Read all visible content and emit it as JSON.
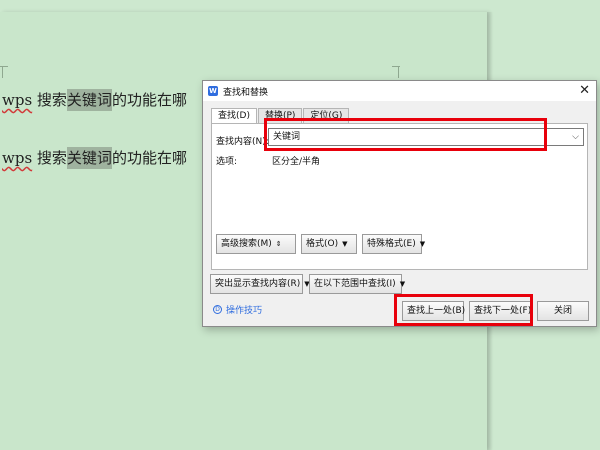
{
  "document": {
    "lines": [
      {
        "latin": "wps",
        "before": " 搜索",
        "highlight": "关键词",
        "after": "的功能在哪"
      },
      {
        "latin": "wps",
        "before": " 搜索",
        "highlight": "关键词",
        "after": "的功能在哪"
      }
    ]
  },
  "dialog": {
    "app_icon": "W",
    "title": "查找和替换",
    "tabs": [
      {
        "label": "查找(D)",
        "active": true
      },
      {
        "label": "替换(P)",
        "active": false
      },
      {
        "label": "定位(G)",
        "active": false
      }
    ],
    "find_label": "查找内容(N):",
    "find_value": "关键词",
    "options_label": "选项:",
    "options_value": "区分全/半角",
    "buttons": {
      "advanced": "高级搜索(M)",
      "format": "格式(O)",
      "special": "特殊格式(E)",
      "highlight": "突出显示查找内容(R)",
      "scope": "在以下范围中查找(I)",
      "find_prev": "查找上一处(B)",
      "find_next": "查找下一处(F)",
      "close": "关闭"
    },
    "tip": "操作技巧"
  },
  "colors": {
    "background": "#cde8cf",
    "highlight": "#9fb39f",
    "annotation_red": "#e8000b",
    "accent": "#2f6ddf"
  }
}
